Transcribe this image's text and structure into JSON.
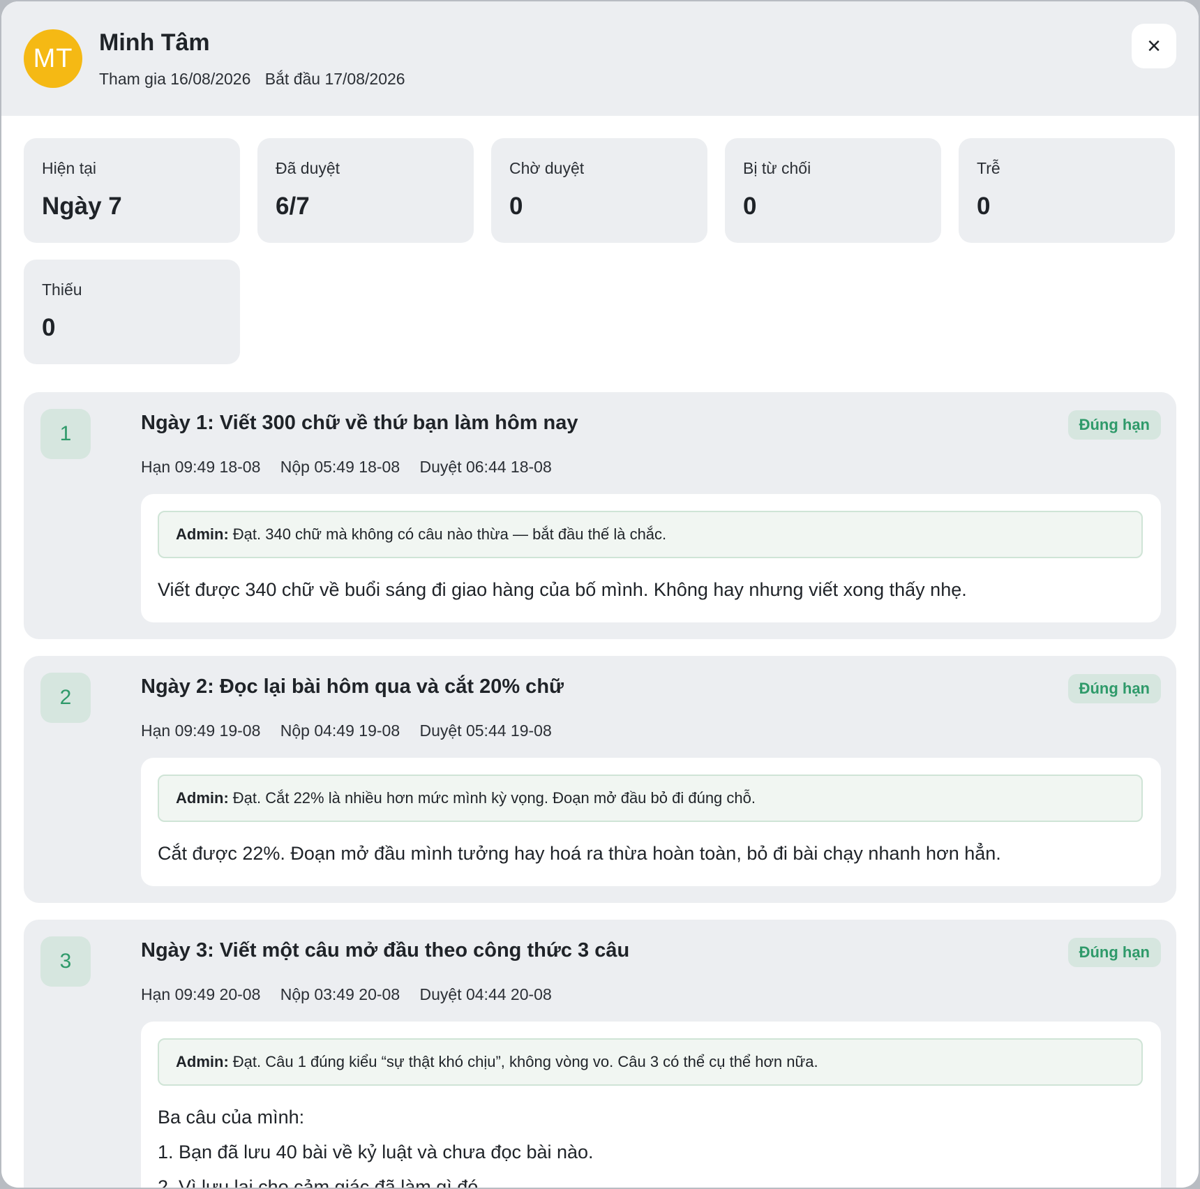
{
  "user": {
    "initials": "MT",
    "name": "Minh Tâm",
    "joined": "Tham gia 16/08/2026",
    "started": "Bắt đầu 17/08/2026"
  },
  "close_icon": "×",
  "stats": [
    {
      "label": "Hiện tại",
      "value": "Ngày 7"
    },
    {
      "label": "Đã duyệt",
      "value": "6/7"
    },
    {
      "label": "Chờ duyệt",
      "value": "0"
    },
    {
      "label": "Bị từ chối",
      "value": "0"
    },
    {
      "label": "Trễ",
      "value": "0"
    },
    {
      "label": "Thiếu",
      "value": "0"
    }
  ],
  "tasks": [
    {
      "num": "1",
      "title": "Ngày 1: Viết 300 chữ về thứ bạn làm hôm nay",
      "badge": "Đúng hạn",
      "deadline": "Hạn 09:49 18-08",
      "submitted": "Nộp 05:49 18-08",
      "approved": "Duyệt 06:44 18-08",
      "admin_label": "Admin:",
      "admin_note": "Đạt. 340 chữ mà không có câu nào thừa — bắt đầu thế là chắc.",
      "submission": [
        "Viết được 340 chữ về buổi sáng đi giao hàng của bố mình. Không hay nhưng viết xong thấy nhẹ."
      ]
    },
    {
      "num": "2",
      "title": "Ngày 2: Đọc lại bài hôm qua và cắt 20% chữ",
      "badge": "Đúng hạn",
      "deadline": "Hạn 09:49 19-08",
      "submitted": "Nộp 04:49 19-08",
      "approved": "Duyệt 05:44 19-08",
      "admin_label": "Admin:",
      "admin_note": "Đạt. Cắt 22% là nhiều hơn mức mình kỳ vọng. Đoạn mở đầu bỏ đi đúng chỗ.",
      "submission": [
        "Cắt được 22%. Đoạn mở đầu mình tưởng hay hoá ra thừa hoàn toàn, bỏ đi bài chạy nhanh hơn hẳn."
      ]
    },
    {
      "num": "3",
      "title": "Ngày 3: Viết một câu mở đầu theo công thức 3 câu",
      "badge": "Đúng hạn",
      "deadline": "Hạn 09:49 20-08",
      "submitted": "Nộp 03:49 20-08",
      "approved": "Duyệt 04:44 20-08",
      "admin_label": "Admin:",
      "admin_note": "Đạt. Câu 1 đúng kiểu “sự thật khó chịu”, không vòng vo. Câu 3 có thể cụ thể hơn nữa.",
      "submission": [
        "Ba câu của mình:",
        "1. Bạn đã lưu 40 bài về kỷ luật và chưa đọc bài nào.",
        "2. Vì lưu lại cho cảm giác đã làm gì đó."
      ]
    }
  ]
}
